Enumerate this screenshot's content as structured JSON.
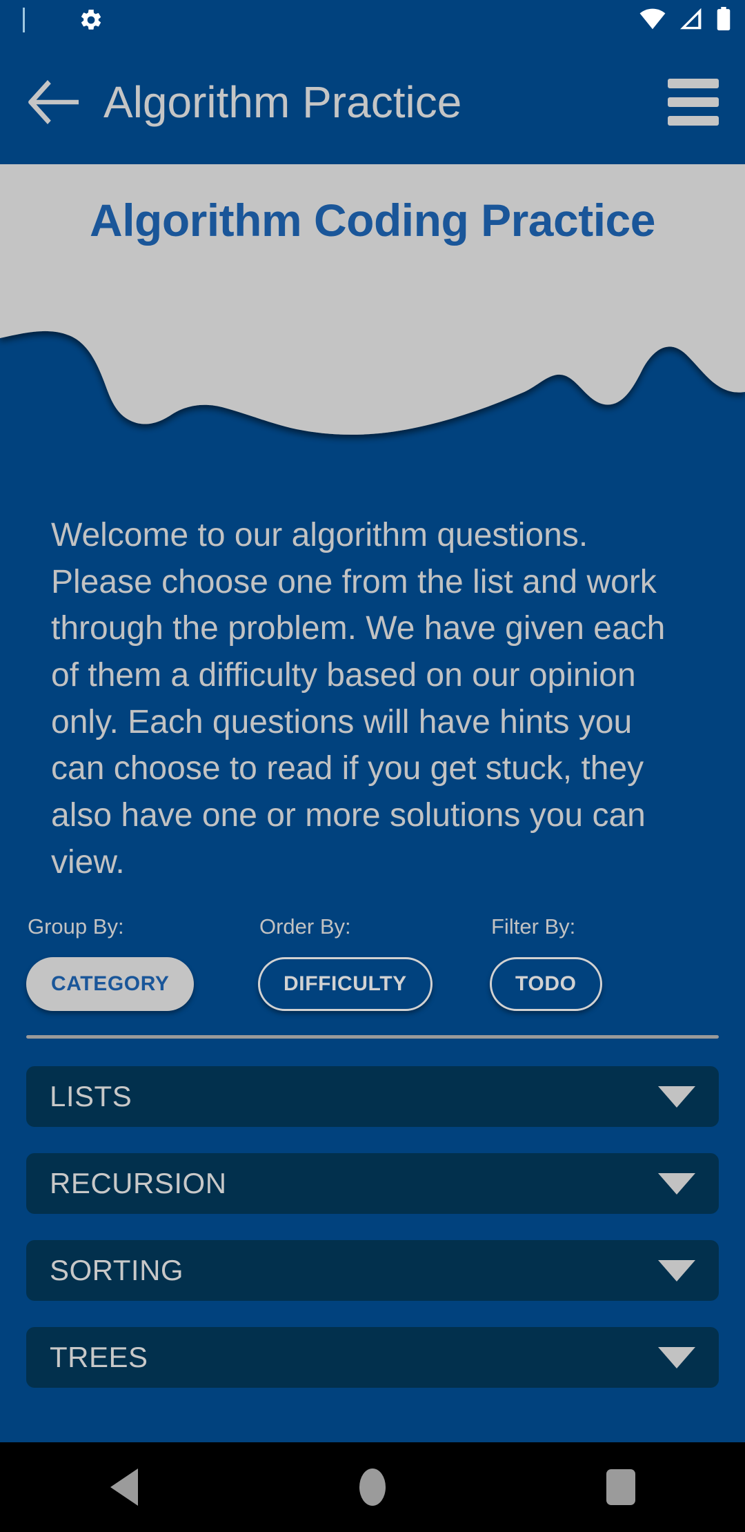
{
  "status_bar": {
    "notification_indicator": "notification-bar",
    "icons_left": [
      "gear-icon"
    ],
    "icons_right": [
      "wifi-icon",
      "signal-icon",
      "battery-icon"
    ]
  },
  "toolbar": {
    "back_label": "back-arrow-icon",
    "title": "Algorithm Practice",
    "menu_label": "hamburger-menu-icon"
  },
  "header": {
    "title": "Algorithm Coding Practice"
  },
  "welcome": {
    "text": "Welcome to our algorithm questions. Please choose one from the list and work through the problem. We have given each of them a difficulty based on our opinion only. Each questions will have hints you can choose to read if you get stuck, they also have one or more solutions you can view."
  },
  "filters": [
    {
      "label": "Group By:",
      "chip": "CATEGORY",
      "selected": true
    },
    {
      "label": "Order By:",
      "chip": "DIFFICULTY",
      "selected": false
    },
    {
      "label": "Filter By:",
      "chip": "TODO",
      "selected": false
    }
  ],
  "categories": [
    {
      "label": "LISTS"
    },
    {
      "label": "RECURSION"
    },
    {
      "label": "SORTING"
    },
    {
      "label": "TREES"
    }
  ],
  "nav_bar": {
    "back": "nav-back-icon",
    "home": "nav-home-icon",
    "recents": "nav-recents-icon"
  },
  "colors": {
    "background": "#01427e",
    "panel": "#02304d",
    "header_blob": "#c4c4c4",
    "header_title": "#1a5699",
    "text_light": "#c2c2c2",
    "nav_bar": "#000000"
  }
}
